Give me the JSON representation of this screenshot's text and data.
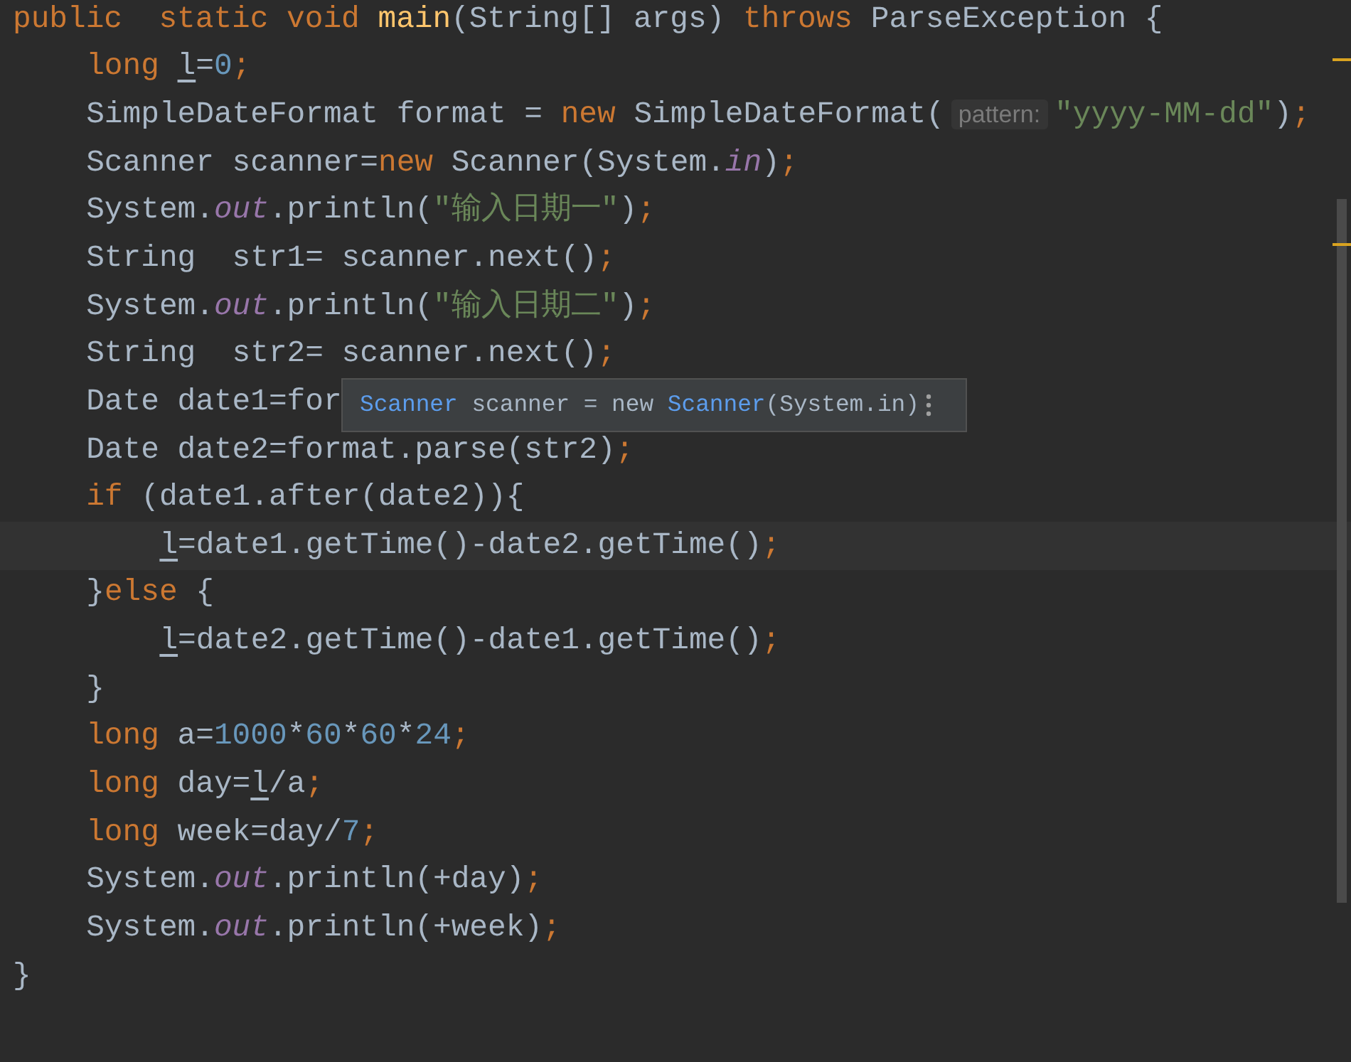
{
  "editor": {
    "lines": [
      {
        "tokens": [
          {
            "text": "public  static void ",
            "kind": "keyword"
          },
          {
            "text": "main",
            "kind": "method"
          },
          {
            "text": "(String[] args) ",
            "kind": "plain"
          },
          {
            "text": "throws",
            "kind": "keyword"
          },
          {
            "text": " ParseException {",
            "kind": "plain"
          }
        ],
        "children": [
          {
            "tokens": [
              {
                "text": "long ",
                "kind": "keyword"
              },
              {
                "text": "l",
                "kind": "var"
              },
              {
                "text": "=",
                "kind": "plain"
              },
              {
                "text": "0",
                "kind": "number"
              },
              {
                "text": ";",
                "kind": "keyword"
              }
            ]
          },
          {
            "tokens": [
              {
                "text": "SimpleDateFormat format = ",
                "kind": "plain"
              },
              {
                "text": "new",
                "kind": "keyword"
              },
              {
                "text": " SimpleDateFormat(",
                "kind": "plain"
              },
              {
                "text": "pattern:",
                "kind": "hint"
              },
              {
                "text": "\"yyyy-MM-dd\"",
                "kind": "string"
              },
              {
                "text": ")",
                "kind": "plain"
              },
              {
                "text": ";",
                "kind": "keyword"
              }
            ]
          },
          {
            "tokens": [
              {
                "text": "Scanner scanner=",
                "kind": "plain"
              },
              {
                "text": "new",
                "kind": "keyword"
              },
              {
                "text": " Scanner(System.",
                "kind": "plain"
              },
              {
                "text": "in",
                "kind": "field"
              },
              {
                "text": ")",
                "kind": "plain"
              },
              {
                "text": ";",
                "kind": "keyword"
              }
            ]
          },
          {
            "tokens": [
              {
                "text": "System.",
                "kind": "plain"
              },
              {
                "text": "out",
                "kind": "field"
              },
              {
                "text": ".println(",
                "kind": "plain"
              },
              {
                "text": "\"输入日期一\"",
                "kind": "string"
              },
              {
                "text": ")",
                "kind": "plain"
              },
              {
                "text": ";",
                "kind": "keyword"
              }
            ]
          },
          {
            "tokens": [
              {
                "text": "String  str1= scanner.next()",
                "kind": "plain"
              },
              {
                "text": ";",
                "kind": "keyword"
              }
            ]
          },
          {
            "tokens": [
              {
                "text": "System.",
                "kind": "plain"
              },
              {
                "text": "out",
                "kind": "field"
              },
              {
                "text": ".println(",
                "kind": "plain"
              },
              {
                "text": "\"输入日期二\"",
                "kind": "string"
              },
              {
                "text": ")",
                "kind": "plain"
              },
              {
                "text": ";",
                "kind": "keyword"
              }
            ]
          },
          {
            "tokens": [
              {
                "text": "String  str2= scanner.next()",
                "kind": "plain"
              },
              {
                "text": ";",
                "kind": "keyword"
              }
            ]
          },
          {
            "tokens": [
              {
                "text": "Date date1=for",
                "kind": "plain"
              }
            ]
          },
          {
            "tokens": [
              {
                "text": "Date date2=format.parse(str2)",
                "kind": "plain"
              },
              {
                "text": ";",
                "kind": "keyword"
              }
            ]
          },
          {
            "tokens": [
              {
                "text": "if",
                "kind": "keyword"
              },
              {
                "text": " (date1.after(date2)){",
                "kind": "plain"
              }
            ],
            "children": [
              {
                "current": true,
                "tokens": [
                  {
                    "text": "l",
                    "kind": "var"
                  },
                  {
                    "text": "=date1.getTime()-date2.getTime()",
                    "kind": "plain"
                  },
                  {
                    "text": ";",
                    "kind": "keyword"
                  }
                ]
              }
            ]
          },
          {
            "tokens": [
              {
                "text": "}",
                "kind": "plain"
              },
              {
                "text": "else",
                "kind": "keyword"
              },
              {
                "text": " {",
                "kind": "plain"
              }
            ],
            "children": [
              {
                "current": false,
                "tokens": [
                  {
                    "text": "l",
                    "kind": "var"
                  },
                  {
                    "text": "=date2.getTime()-date1.getTime()",
                    "kind": "plain"
                  },
                  {
                    "text": ";",
                    "kind": "keyword"
                  }
                ]
              }
            ]
          },
          {
            "tokens": [
              {
                "text": "}",
                "kind": "plain"
              }
            ]
          },
          {
            "tokens": [
              {
                "text": "long",
                "kind": "keyword"
              },
              {
                "text": " a=",
                "kind": "plain"
              },
              {
                "text": "1000",
                "kind": "number"
              },
              {
                "text": "*",
                "kind": "plain"
              },
              {
                "text": "60",
                "kind": "number"
              },
              {
                "text": "*",
                "kind": "plain"
              },
              {
                "text": "60",
                "kind": "number"
              },
              {
                "text": "*",
                "kind": "plain"
              },
              {
                "text": "24",
                "kind": "number"
              },
              {
                "text": ";",
                "kind": "keyword"
              }
            ]
          },
          {
            "tokens": [
              {
                "text": "long",
                "kind": "keyword"
              },
              {
                "text": " day=",
                "kind": "plain"
              },
              {
                "text": "l",
                "kind": "var"
              },
              {
                "text": "/a",
                "kind": "plain"
              },
              {
                "text": ";",
                "kind": "keyword"
              }
            ]
          },
          {
            "tokens": [
              {
                "text": "long",
                "kind": "keyword"
              },
              {
                "text": " week=day/",
                "kind": "plain"
              },
              {
                "text": "7",
                "kind": "number"
              },
              {
                "text": ";",
                "kind": "keyword"
              }
            ]
          },
          {
            "tokens": [
              {
                "text": "System.",
                "kind": "plain"
              },
              {
                "text": "out",
                "kind": "field"
              },
              {
                "text": ".println(+day)",
                "kind": "plain"
              },
              {
                "text": ";",
                "kind": "keyword"
              }
            ]
          },
          {
            "tokens": [
              {
                "text": "System.",
                "kind": "plain"
              },
              {
                "text": "out",
                "kind": "field"
              },
              {
                "text": ".println(+week)",
                "kind": "plain"
              },
              {
                "text": ";",
                "kind": "keyword"
              }
            ]
          }
        ]
      },
      {
        "tokens": [
          {
            "text": "}",
            "kind": "plain"
          }
        ]
      }
    ],
    "tooltip": {
      "segments": [
        {
          "text": "Scanner",
          "kind": "type"
        },
        {
          "text": " scanner = new ",
          "kind": "plain"
        },
        {
          "text": "Scanner",
          "kind": "type"
        },
        {
          "text": "(System.in)",
          "kind": "plain"
        }
      ]
    }
  }
}
